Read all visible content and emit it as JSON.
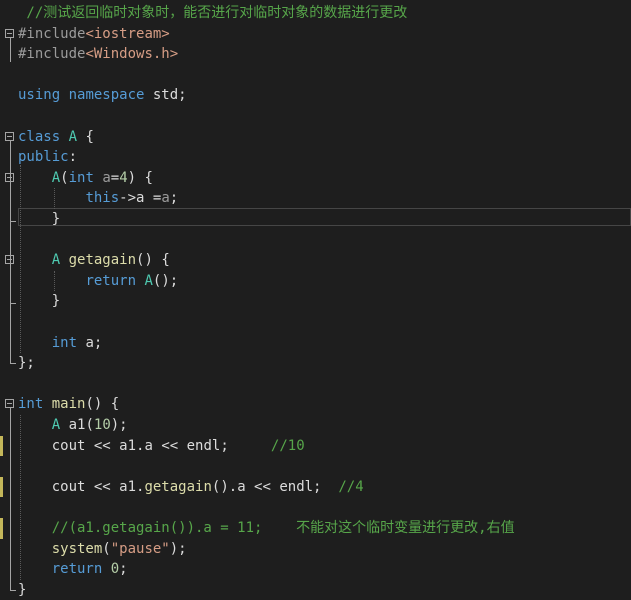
{
  "editor": {
    "lines": [
      {
        "tokens": [
          {
            "c": "cm",
            "t": " //测试返回临时对象时，能否进行对临时对象的数据进行更改"
          }
        ]
      },
      {
        "tokens": [
          {
            "c": "pp",
            "t": "#include"
          },
          {
            "c": "inc",
            "t": "<iostream>"
          }
        ]
      },
      {
        "tokens": [
          {
            "c": "pp",
            "t": "#include"
          },
          {
            "c": "inc",
            "t": "<Windows.h>"
          }
        ]
      },
      {
        "tokens": []
      },
      {
        "tokens": [
          {
            "c": "kw",
            "t": "using"
          },
          {
            "c": "pl",
            "t": " "
          },
          {
            "c": "kw",
            "t": "namespace"
          },
          {
            "c": "pl",
            "t": " std;"
          }
        ]
      },
      {
        "tokens": []
      },
      {
        "tokens": [
          {
            "c": "kw",
            "t": "class"
          },
          {
            "c": "pl",
            "t": " "
          },
          {
            "c": "ty",
            "t": "A"
          },
          {
            "c": "pl",
            "t": " {"
          }
        ]
      },
      {
        "tokens": [
          {
            "c": "kw",
            "t": "public"
          },
          {
            "c": "pl",
            "t": ":"
          }
        ]
      },
      {
        "tokens": [
          {
            "c": "pl",
            "t": "    "
          },
          {
            "c": "ty",
            "t": "A"
          },
          {
            "c": "pl",
            "t": "("
          },
          {
            "c": "kw",
            "t": "int"
          },
          {
            "c": "pl",
            "t": " "
          },
          {
            "c": "prm",
            "t": "a"
          },
          {
            "c": "pl",
            "t": "="
          },
          {
            "c": "num",
            "t": "4"
          },
          {
            "c": "pl",
            "t": ") {"
          }
        ]
      },
      {
        "tokens": [
          {
            "c": "pl",
            "t": "        "
          },
          {
            "c": "kw",
            "t": "this"
          },
          {
            "c": "pl",
            "t": "->"
          },
          {
            "c": "var",
            "t": "a"
          },
          {
            "c": "pl",
            "t": " ="
          },
          {
            "c": "prm",
            "t": "a"
          },
          {
            "c": "pl",
            "t": ";"
          }
        ]
      },
      {
        "tokens": [
          {
            "c": "pl",
            "t": "    }"
          }
        ]
      },
      {
        "tokens": []
      },
      {
        "tokens": [
          {
            "c": "pl",
            "t": "    "
          },
          {
            "c": "ty",
            "t": "A"
          },
          {
            "c": "pl",
            "t": " "
          },
          {
            "c": "fn",
            "t": "getagain"
          },
          {
            "c": "pl",
            "t": "() {"
          }
        ]
      },
      {
        "tokens": [
          {
            "c": "pl",
            "t": "        "
          },
          {
            "c": "kw",
            "t": "return"
          },
          {
            "c": "pl",
            "t": " "
          },
          {
            "c": "ty",
            "t": "A"
          },
          {
            "c": "pl",
            "t": "();"
          }
        ]
      },
      {
        "tokens": [
          {
            "c": "pl",
            "t": "    }"
          }
        ]
      },
      {
        "tokens": []
      },
      {
        "tokens": [
          {
            "c": "pl",
            "t": "    "
          },
          {
            "c": "kw",
            "t": "int"
          },
          {
            "c": "pl",
            "t": " "
          },
          {
            "c": "var",
            "t": "a"
          },
          {
            "c": "pl",
            "t": ";"
          }
        ]
      },
      {
        "tokens": [
          {
            "c": "pl",
            "t": "};"
          }
        ]
      },
      {
        "tokens": []
      },
      {
        "tokens": [
          {
            "c": "kw",
            "t": "int"
          },
          {
            "c": "pl",
            "t": " "
          },
          {
            "c": "fn",
            "t": "main"
          },
          {
            "c": "pl",
            "t": "() {"
          }
        ]
      },
      {
        "tokens": [
          {
            "c": "pl",
            "t": "    "
          },
          {
            "c": "ty",
            "t": "A"
          },
          {
            "c": "pl",
            "t": " "
          },
          {
            "c": "var",
            "t": "a1"
          },
          {
            "c": "pl",
            "t": "("
          },
          {
            "c": "num",
            "t": "10"
          },
          {
            "c": "pl",
            "t": ");"
          }
        ]
      },
      {
        "tokens": [
          {
            "c": "pl",
            "t": "    cout << "
          },
          {
            "c": "var",
            "t": "a1"
          },
          {
            "c": "pl",
            "t": "."
          },
          {
            "c": "var",
            "t": "a"
          },
          {
            "c": "pl",
            "t": " << endl;     "
          },
          {
            "c": "cm",
            "t": "//10"
          }
        ]
      },
      {
        "tokens": []
      },
      {
        "tokens": [
          {
            "c": "pl",
            "t": "    cout << "
          },
          {
            "c": "var",
            "t": "a1"
          },
          {
            "c": "pl",
            "t": "."
          },
          {
            "c": "fn",
            "t": "getagain"
          },
          {
            "c": "pl",
            "t": "()."
          },
          {
            "c": "var",
            "t": "a"
          },
          {
            "c": "pl",
            "t": " << endl;  "
          },
          {
            "c": "cm",
            "t": "//4"
          }
        ]
      },
      {
        "tokens": []
      },
      {
        "tokens": [
          {
            "c": "pl",
            "t": "    "
          },
          {
            "c": "cm",
            "t": "//(a1.getagain()).a = 11;    不能对这个临时变量进行更改,右值"
          }
        ]
      },
      {
        "tokens": [
          {
            "c": "pl",
            "t": "    "
          },
          {
            "c": "fn",
            "t": "system"
          },
          {
            "c": "pl",
            "t": "("
          },
          {
            "c": "str",
            "t": "\"pause\""
          },
          {
            "c": "pl",
            "t": ");"
          }
        ]
      },
      {
        "tokens": [
          {
            "c": "pl",
            "t": "    "
          },
          {
            "c": "kw",
            "t": "return"
          },
          {
            "c": "pl",
            "t": " "
          },
          {
            "c": "num",
            "t": "0"
          },
          {
            "c": "pl",
            "t": ";"
          }
        ]
      },
      {
        "tokens": [
          {
            "c": "pl",
            "t": "}"
          }
        ]
      }
    ],
    "folds": [
      1,
      6,
      8,
      12,
      19
    ]
  }
}
